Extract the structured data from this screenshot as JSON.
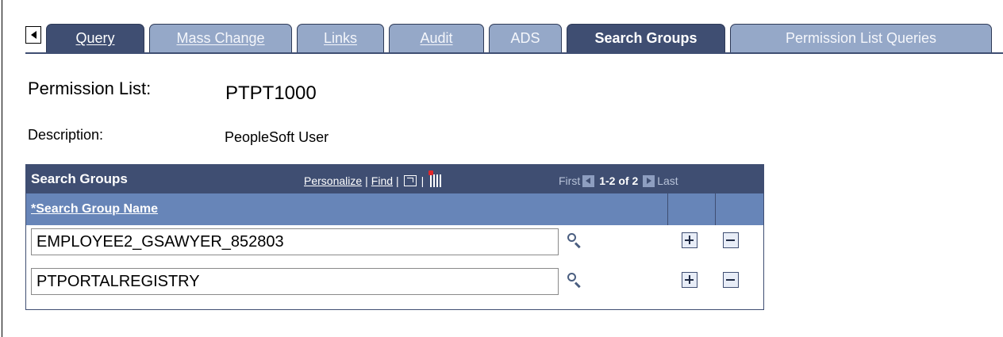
{
  "tabs": [
    {
      "label": "Query",
      "state": "inactive-dark",
      "underline": true
    },
    {
      "label": "Mass Change",
      "state": "inactive",
      "underline": true
    },
    {
      "label": "Links",
      "state": "inactive",
      "underline": true
    },
    {
      "label": "Audit",
      "state": "inactive",
      "underline": true
    },
    {
      "label": "ADS",
      "state": "inactive",
      "underline": false
    },
    {
      "label": "Search Groups",
      "state": "active",
      "underline": false
    },
    {
      "label": "Permission List Queries",
      "state": "inactive",
      "underline": false
    }
  ],
  "header": {
    "permission_list_label": "Permission List:",
    "permission_list_value": "PTPT1000",
    "description_label": "Description:",
    "description_value": "PeopleSoft User"
  },
  "grid": {
    "title": "Search Groups",
    "personalize": "Personalize",
    "find": "Find",
    "separator": "|",
    "first": "First",
    "count": "1-2 of 2",
    "last": "Last",
    "column_name": "*Search Group Name",
    "rows": [
      {
        "value": "EMPLOYEE2_GSAWYER_852803"
      },
      {
        "value": "PTPORTALREGISTRY"
      }
    ]
  },
  "colors": {
    "tab_active": "#3f4e72",
    "tab_inactive": "#95a8c8",
    "grid_header": "#3f4e72",
    "column_header": "#6785b8"
  }
}
